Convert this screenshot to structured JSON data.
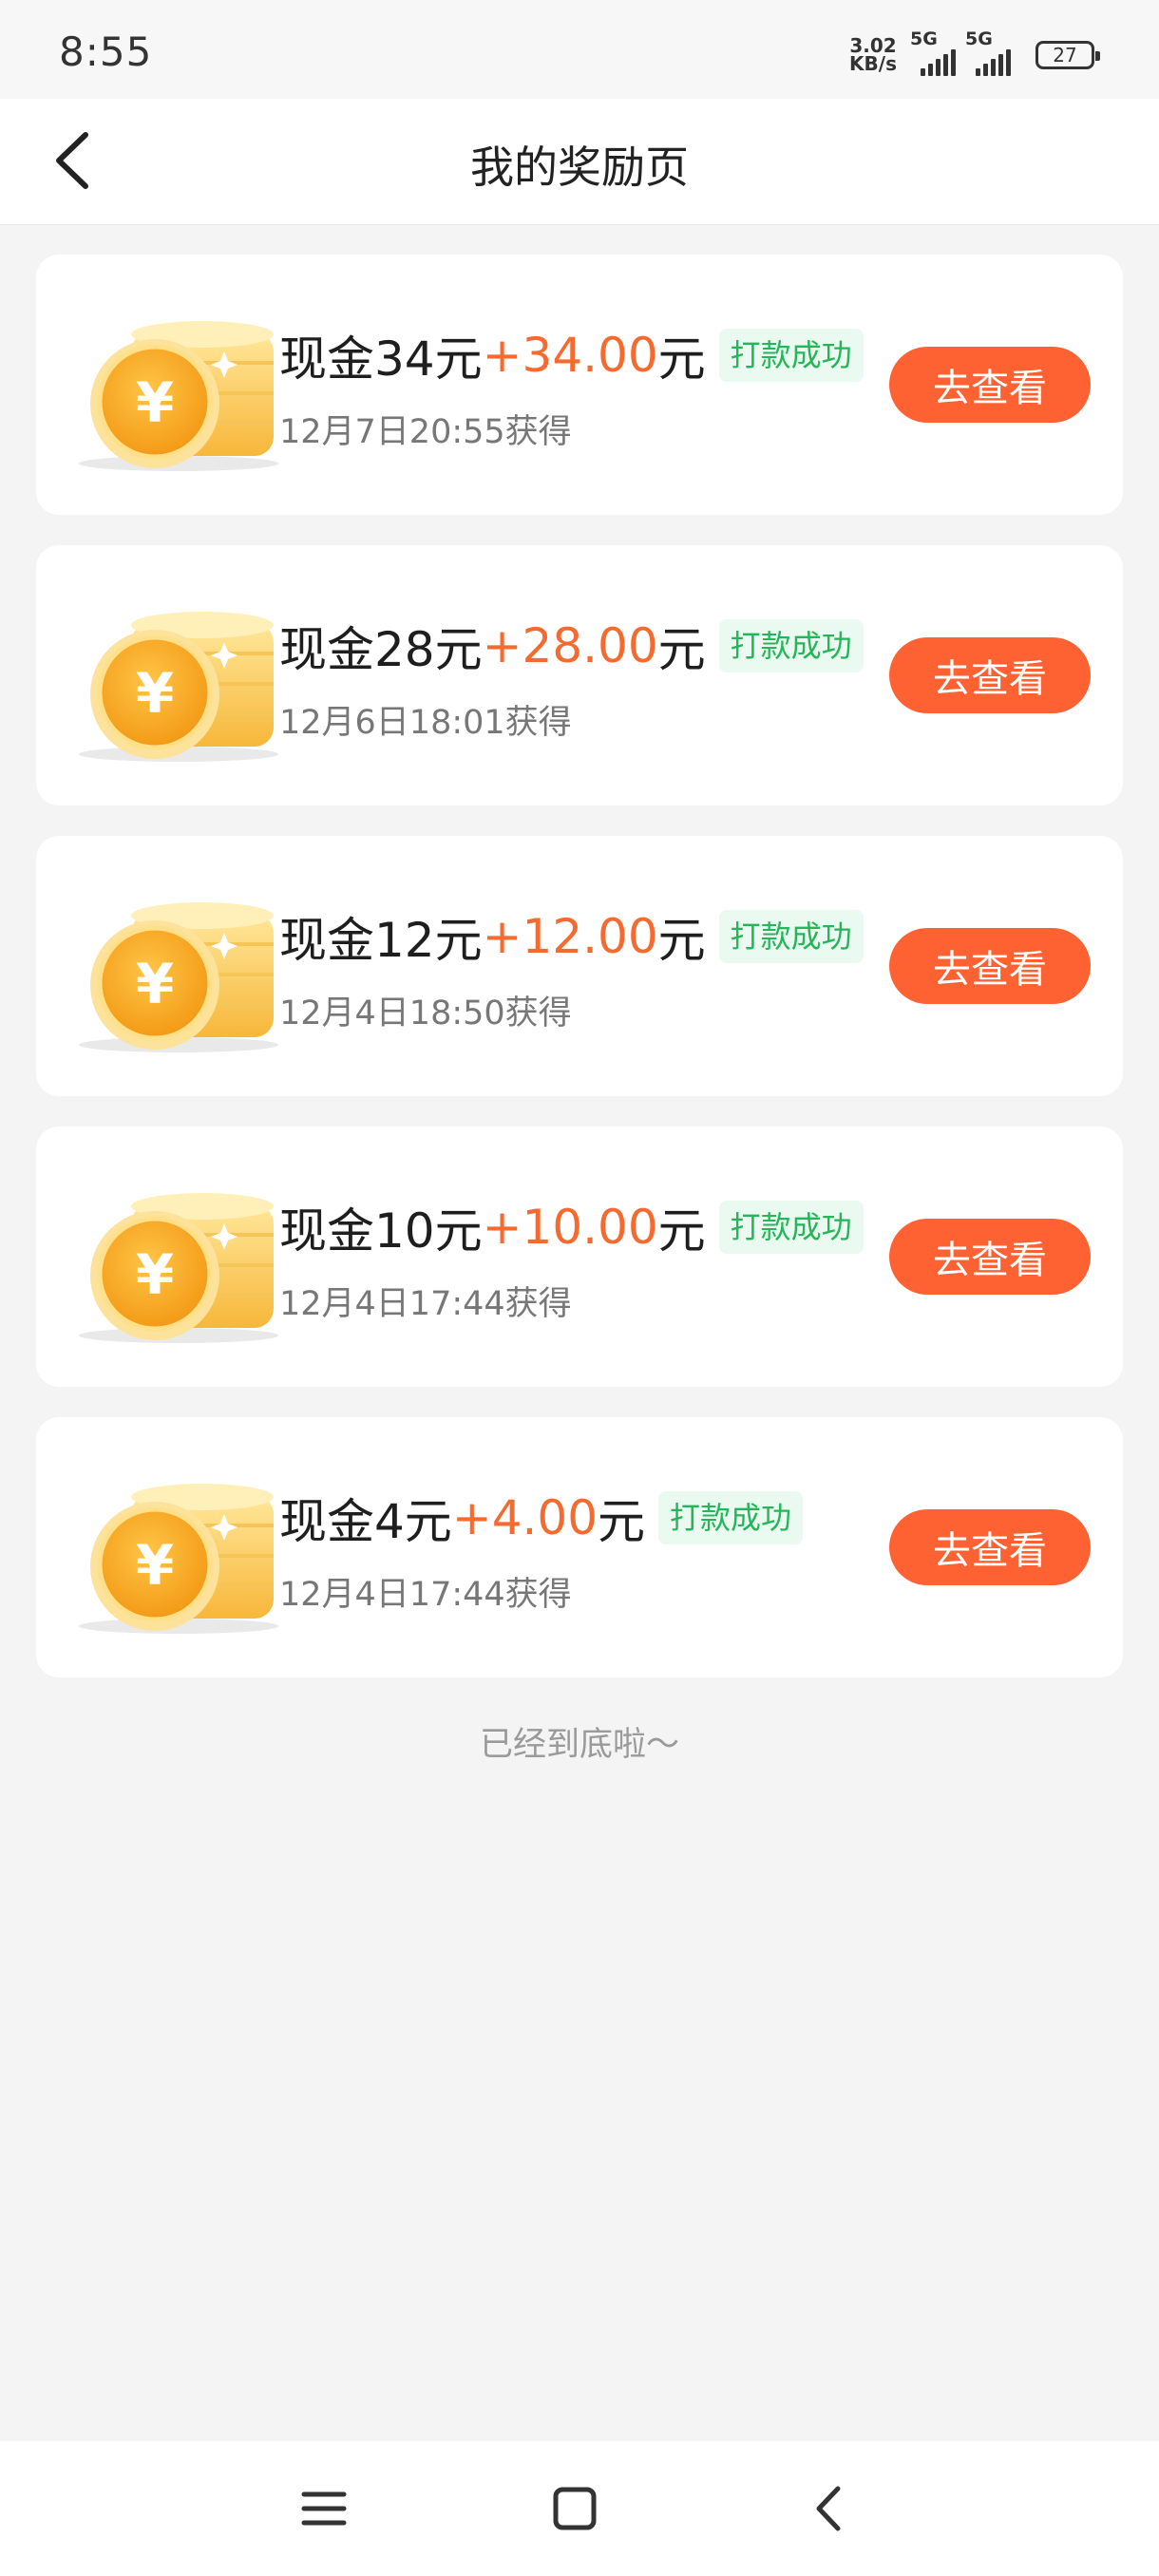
{
  "status_bar": {
    "time": "8:55",
    "net_speed_value": "3.02",
    "net_speed_unit": "KB/s",
    "sim1_label": "5G",
    "sim2_label": "5G",
    "battery_level": "27"
  },
  "header": {
    "title": "我的奖励页",
    "back_icon": "chevron-left-icon"
  },
  "rewards": [
    {
      "title": "现金34元",
      "amount": "+34.00",
      "unit": "元",
      "status": "打款成功",
      "date": "12月7日20:55获得",
      "button": "去查看"
    },
    {
      "title": "现金28元",
      "amount": "+28.00",
      "unit": "元",
      "status": "打款成功",
      "date": "12月6日18:01获得",
      "button": "去查看"
    },
    {
      "title": "现金12元",
      "amount": "+12.00",
      "unit": "元",
      "status": "打款成功",
      "date": "12月4日18:50获得",
      "button": "去查看"
    },
    {
      "title": "现金10元",
      "amount": "+10.00",
      "unit": "元",
      "status": "打款成功",
      "date": "12月4日17:44获得",
      "button": "去查看"
    },
    {
      "title": "现金4元",
      "amount": "+4.00",
      "unit": "元",
      "status": "打款成功",
      "date": "12月4日17:44获得",
      "button": "去查看"
    }
  ],
  "footer_text": "已经到底啦～",
  "nav": {
    "menu_icon": "menu-icon",
    "home_icon": "home-square-icon",
    "back_icon": "back-triangle-icon"
  },
  "colors": {
    "accent": "#ff6232",
    "amount": "#f56a2f",
    "success": "#27b55a",
    "success_bg": "#eafaf0"
  }
}
